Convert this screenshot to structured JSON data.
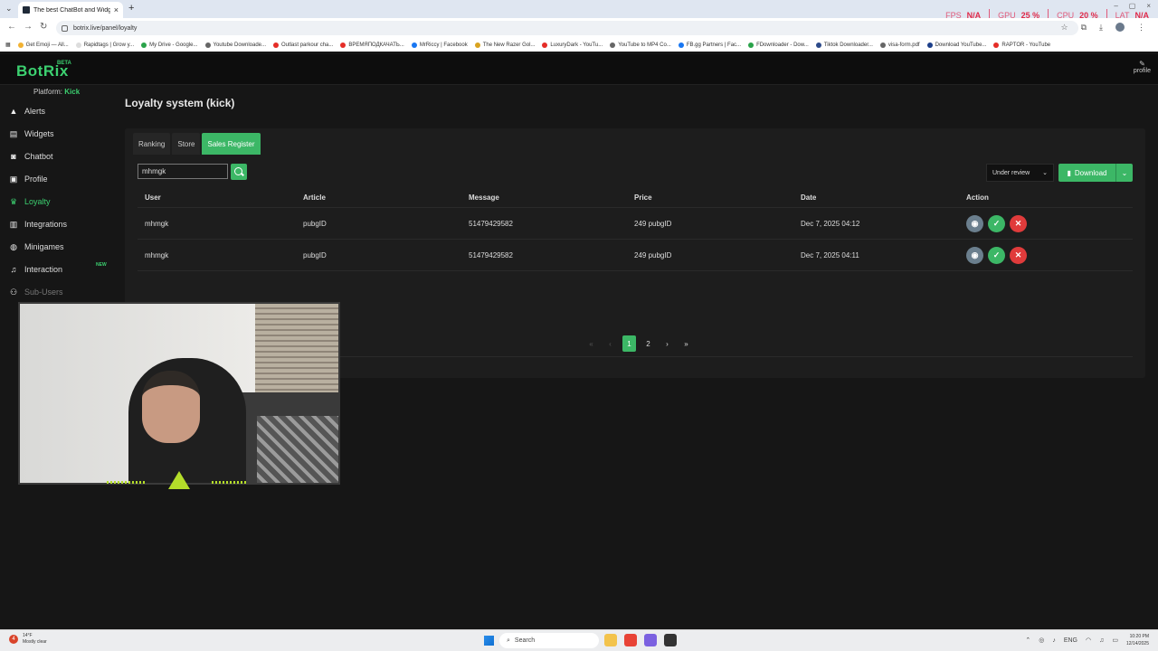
{
  "browser": {
    "tab_title": "The best ChatBot and Widgets",
    "url": "botrix.live/panel/loyalty",
    "bookmarks": [
      "Get Emoji — All...",
      "Rapidtags | Grow y...",
      "My Drive - Google...",
      "Youtube Downloade...",
      "Outlast parkour cha...",
      "ВРЕМЯПОДКАЧАТЬ...",
      "MrRiccy | Facebook",
      "The New Razer Gol...",
      "LuxuryDark - YouTu...",
      "YouTube to MP4 Co...",
      "FB.gg Partners | Fac...",
      "FDownloader - Dow...",
      "Tiktok Downloader...",
      "visa-form.pdf",
      "Download YouTube...",
      "RAPTOR - YouTube"
    ]
  },
  "hud": {
    "fps_label": "FPS",
    "fps_value": "N/A",
    "gpu_label": "GPU",
    "gpu_value": "25 %",
    "cpu_label": "CPU",
    "cpu_value": "20 %",
    "lat_label": "LAT",
    "lat_value": "N/A",
    "color": "#e02a4a"
  },
  "app": {
    "logo": "BotRix",
    "beta": "BETA",
    "profile_label": "profile",
    "platform_label": "Platform:",
    "platform_value": "Kick",
    "accent": "#3cb766",
    "nav": [
      {
        "label": "Alerts",
        "icon": "warning-icon"
      },
      {
        "label": "Widgets",
        "icon": "widgets-icon"
      },
      {
        "label": "Chatbot",
        "icon": "robot-icon"
      },
      {
        "label": "Profile",
        "icon": "id-card-icon"
      },
      {
        "label": "Loyalty",
        "icon": "trophy-icon",
        "active": true
      },
      {
        "label": "Integrations",
        "icon": "integrations-icon"
      },
      {
        "label": "Minigames",
        "icon": "gamepad-icon"
      },
      {
        "label": "Interaction",
        "icon": "music-icon",
        "badge": "NEW"
      },
      {
        "label": "Sub-Users",
        "icon": "users-icon"
      }
    ],
    "page_title": "Loyalty system (kick)",
    "tabs": [
      "Ranking",
      "Store",
      "Sales Register"
    ],
    "active_tab": "Sales Register",
    "search_value": "mhmgk",
    "status_filter": "Under review",
    "download_label": "Download",
    "table": {
      "headers": [
        "User",
        "Article",
        "Message",
        "Price",
        "Date",
        "Action"
      ],
      "rows": [
        {
          "user": "mhmgk",
          "article": "pubgID",
          "message": "51479429582",
          "price": "249 pubgID",
          "date": "Dec 7, 2025 04:12"
        },
        {
          "user": "mhmgk",
          "article": "pubgID",
          "message": "51479429582",
          "price": "249 pubgID",
          "date": "Dec 7, 2025 04:11"
        }
      ]
    },
    "pagination": {
      "first": "«",
      "prev": "‹",
      "pages": [
        "1",
        "2"
      ],
      "current": "1",
      "next": "›",
      "last": "»"
    }
  },
  "taskbar": {
    "weather_temp": "14°F",
    "weather_desc": "Mostly clear",
    "search_placeholder": "Search",
    "lang": "ENG",
    "time": "10:20 PM",
    "date": "12/14/2025"
  }
}
